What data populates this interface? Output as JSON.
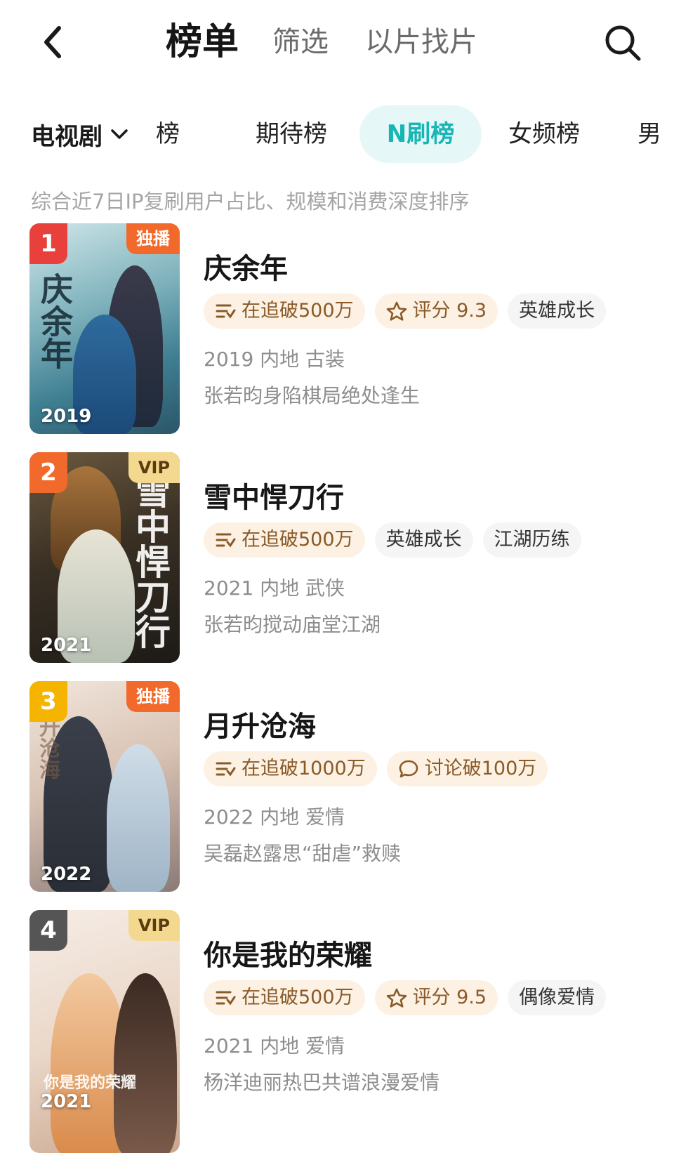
{
  "header": {
    "tabs": [
      "榜单",
      "筛选",
      "以片找片"
    ]
  },
  "categories": {
    "dropdown": "电视剧",
    "tabs": [
      "升榜",
      "期待榜",
      "N刷榜",
      "女频榜",
      "男"
    ],
    "active": "N刷榜"
  },
  "subtitle": "综合近7日IP复刷用户占比、规模和消费深度排序",
  "items": [
    {
      "rank": "1",
      "badge": "独播",
      "poster_year": "2019",
      "poster_text": "庆余年",
      "title": "庆余年",
      "tags": [
        {
          "icon": "follow-icon",
          "text": "在追破500万"
        },
        {
          "icon": "star-icon",
          "text": "评分 9.3"
        },
        {
          "text": "英雄成长"
        }
      ],
      "meta": "2019 内地 古装",
      "desc": "张若昀身陷棋局绝处逢生"
    },
    {
      "rank": "2",
      "badge": "VIP",
      "poster_year": "2021",
      "poster_text": "雪中悍刀行",
      "title": "雪中悍刀行",
      "tags": [
        {
          "icon": "follow-icon",
          "text": "在追破500万"
        },
        {
          "text": "英雄成长"
        },
        {
          "text": "江湖历练"
        }
      ],
      "meta": "2021 内地 武侠",
      "desc": "张若昀搅动庙堂江湖"
    },
    {
      "rank": "3",
      "badge": "独播",
      "poster_year": "2022",
      "poster_text": "月升沧海",
      "title": "月升沧海",
      "tags": [
        {
          "icon": "follow-icon",
          "text": "在追破1000万"
        },
        {
          "icon": "comment-icon",
          "text": "讨论破100万"
        }
      ],
      "meta": "2022 内地 爱情",
      "desc": "吴磊赵露思“甜虐”救赎"
    },
    {
      "rank": "4",
      "badge": "VIP",
      "poster_year": "2021",
      "poster_text": "你是我的荣耀",
      "title": "你是我的荣耀",
      "tags": [
        {
          "icon": "follow-icon",
          "text": "在追破500万"
        },
        {
          "icon": "star-icon",
          "text": "评分 9.5"
        },
        {
          "text": "偶像爱情"
        }
      ],
      "meta": "2021 内地 爱情",
      "desc": "杨洋迪丽热巴共谱浪漫爱情"
    }
  ],
  "colors": {
    "accent": "#17b6b6",
    "accent_bg": "#e6f7f7",
    "hot_tag_bg": "#fcf1e3",
    "hot_tag_text": "#8a5a28"
  }
}
